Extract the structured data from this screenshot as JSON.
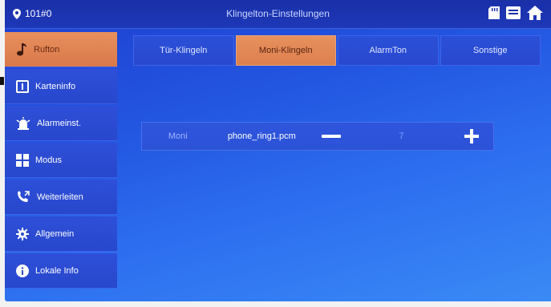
{
  "header": {
    "location": "101#0",
    "title": "Klingelton-Einstellungen",
    "icons": [
      "sd-card-icon",
      "message-icon",
      "home-icon"
    ]
  },
  "sidebar": {
    "items": [
      {
        "label": "Rufton",
        "icon": "music-note-icon",
        "active": true
      },
      {
        "label": "Karteninfo",
        "icon": "card-icon",
        "active": false
      },
      {
        "label": "Alarmeinst.",
        "icon": "alarm-light-icon",
        "active": false
      },
      {
        "label": "Modus",
        "icon": "grid-icon",
        "active": false
      },
      {
        "label": "Weiterleiten",
        "icon": "call-forward-icon",
        "active": false
      },
      {
        "label": "Allgemein",
        "icon": "gear-icon",
        "active": false
      },
      {
        "label": "Lokale Info",
        "icon": "info-icon",
        "active": false
      }
    ]
  },
  "tabs": [
    {
      "label": "Tür-Klingeln",
      "active": false
    },
    {
      "label": "Moni-Klingeln",
      "active": true
    },
    {
      "label": "AlarmTon",
      "active": false
    },
    {
      "label": "Sonstige",
      "active": false
    }
  ],
  "ring_setting": {
    "label": "Moni",
    "file": "phone_ring1.pcm",
    "volume": "7"
  },
  "colors": {
    "accent_active": "#dd7f4e",
    "background_blue": "#2255e0",
    "topbar": "#1a2fa8"
  }
}
